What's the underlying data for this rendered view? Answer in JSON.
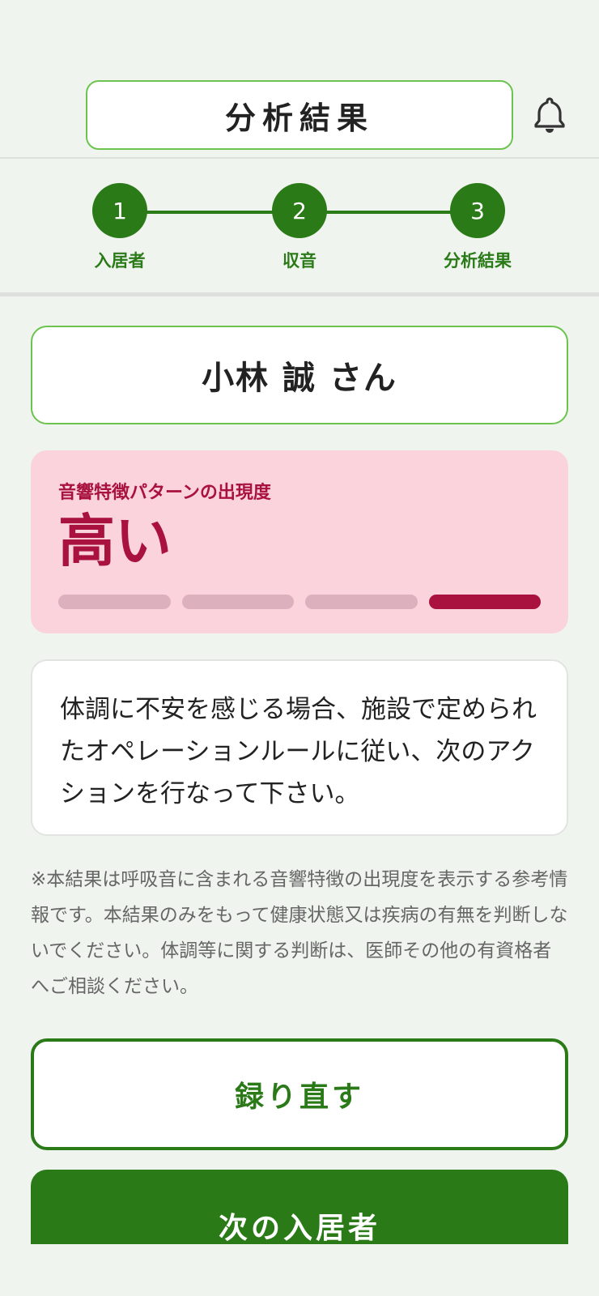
{
  "header": {
    "title": "分析結果",
    "bell_icon": "bell-icon"
  },
  "stepper": {
    "steps": [
      {
        "number": "1",
        "label": "入居者"
      },
      {
        "number": "2",
        "label": "収音"
      },
      {
        "number": "3",
        "label": "分析結果"
      }
    ],
    "current_step": 3
  },
  "resident": {
    "name": "小林 誠 さん"
  },
  "result": {
    "label": "音響特徴パターンの出現度",
    "value": "高い",
    "level": 4,
    "level_max": 4,
    "color": "#a9123f",
    "background": "#fbd3dc"
  },
  "message": "体調に不安を感じる場合、施設で定められたオペレーションルールに従い、次のアクションを行なって下さい。",
  "disclaimer": "※本結果は呼吸音に含まれる音響特徴の出現度を表示する参考情報です。本結果のみをもって健康状態又は疾病の有無を判断しないでください。体調等に関する判断は、医師その他の有資格者へご相談ください。",
  "buttons": {
    "redo": "録り直す",
    "next": "次の入居者"
  },
  "colors": {
    "primary": "#2a7a18",
    "accent_border": "#6cc44f",
    "background": "#eff4ee"
  }
}
